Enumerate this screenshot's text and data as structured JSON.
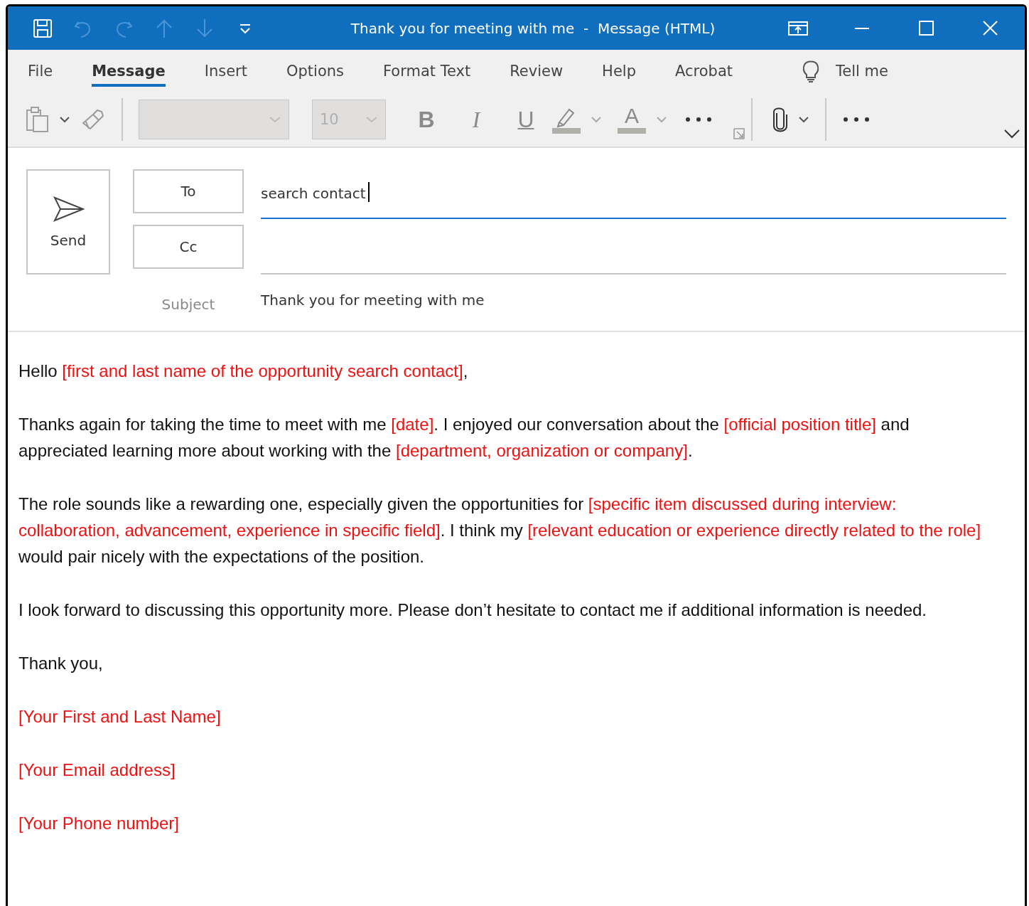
{
  "window": {
    "title": "Thank you for meeting with me  -  Message (HTML)"
  },
  "quick_access": [
    {
      "kind": "save",
      "disabled": false
    },
    {
      "kind": "undo",
      "disabled": true
    },
    {
      "kind": "redo",
      "disabled": true
    },
    {
      "kind": "up",
      "disabled": true
    },
    {
      "kind": "down",
      "disabled": true
    },
    {
      "kind": "customize",
      "disabled": false
    }
  ],
  "tabs": [
    {
      "label": "File",
      "selected": false
    },
    {
      "label": "Message",
      "selected": true
    },
    {
      "label": "Insert",
      "selected": false
    },
    {
      "label": "Options",
      "selected": false
    },
    {
      "label": "Format Text",
      "selected": false
    },
    {
      "label": "Review",
      "selected": false
    },
    {
      "label": "Help",
      "selected": false
    },
    {
      "label": "Acrobat",
      "selected": false
    }
  ],
  "tell_me": "Tell me",
  "toolbar": {
    "font_name_box": {
      "disabled": true
    },
    "font_size_box": {
      "value": "10",
      "disabled": true
    },
    "bold": "B",
    "italic": "I",
    "underline": "U",
    "font_color": "A"
  },
  "header": {
    "send": "Send",
    "to_button": "To",
    "cc_button": "Cc",
    "to_field": {
      "value": "search contact",
      "focused": true
    },
    "subject_label": "Subject",
    "subject": "Thank you for meeting with me"
  },
  "body": [
    [
      {
        "kind": "plain",
        "text": "Hello "
      },
      {
        "kind": "template",
        "text": "[first and last name of the opportunity search contact]"
      },
      {
        "kind": "plain",
        "text": ","
      }
    ],
    [
      {
        "kind": "plain",
        "text": "Thanks again for taking the time to meet with me "
      },
      {
        "kind": "template",
        "text": "[date]"
      },
      {
        "kind": "plain",
        "text": ". I enjoyed our conversation about the "
      },
      {
        "kind": "template",
        "text": "[official position title]"
      },
      {
        "kind": "plain",
        "text": " and appreciated learning more about working with the "
      },
      {
        "kind": "template",
        "text": "[department, organization or company]"
      },
      {
        "kind": "plain",
        "text": "."
      }
    ],
    [
      {
        "kind": "plain",
        "text": "The role sounds like a rewarding one, especially given the opportunities for "
      },
      {
        "kind": "template",
        "text": "[specific item discussed during interview: collaboration, advancement, experience in specific field]"
      },
      {
        "kind": "plain",
        "text": ". I think my "
      },
      {
        "kind": "template",
        "text": "[relevant education or experience directly related to the role]"
      },
      {
        "kind": "plain",
        "text": " would pair nicely with the expectations of the position."
      }
    ],
    [
      {
        "kind": "plain",
        "text": "I look forward to discussing this opportunity more. Please don’t hesitate to contact me if additional information is needed."
      }
    ],
    [
      {
        "kind": "plain",
        "text": "Thank you,"
      }
    ],
    [
      {
        "kind": "template",
        "text": "[Your First and Last Name]"
      }
    ],
    [
      {
        "kind": "template",
        "text": "[Your Email address]"
      }
    ],
    [
      {
        "kind": "template",
        "text": "[Your Phone number]"
      }
    ]
  ]
}
